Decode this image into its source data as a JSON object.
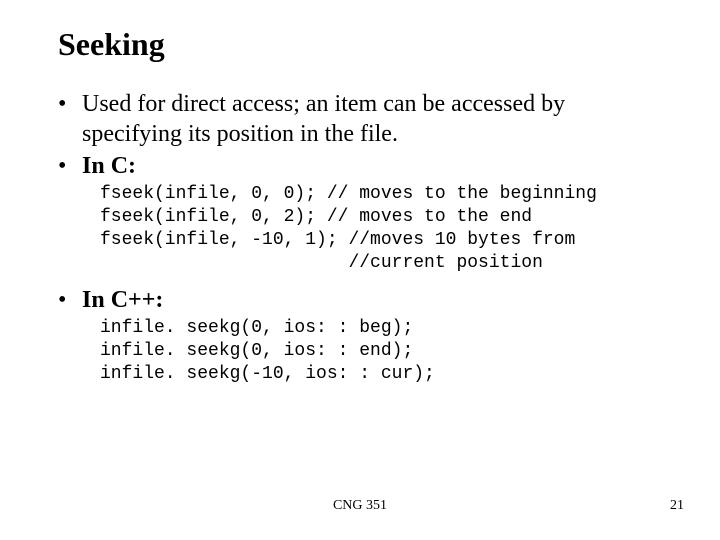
{
  "title": "Seeking",
  "bullets": {
    "b1": "Used for direct access; an item can be accessed by specifying its position in the file.",
    "b2": "In C:",
    "b3": "In C++:"
  },
  "code": {
    "c_block": "fseek(infile, 0, 0); // moves to the beginning\nfseek(infile, 0, 2); // moves to the end\nfseek(infile, -10, 1); //moves 10 bytes from\n                       //current position",
    "cpp_block": "infile. seekg(0, ios: : beg);\ninfile. seekg(0, ios: : end);\ninfile. seekg(-10, ios: : cur);"
  },
  "footer": {
    "center": "CNG 351",
    "right": "21"
  }
}
